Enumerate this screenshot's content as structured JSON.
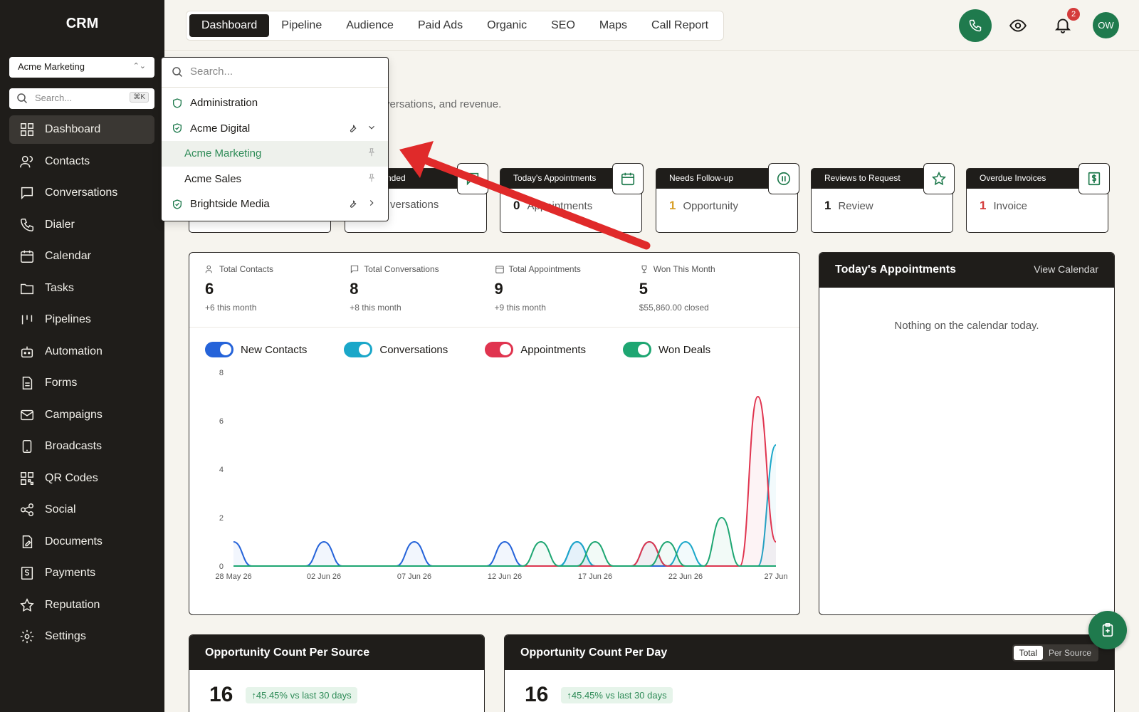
{
  "app": {
    "title": "CRM"
  },
  "sidebar": {
    "account": "Acme Marketing",
    "search_placeholder": "Search...",
    "search_shortcut": "⌘K",
    "items": [
      {
        "label": "Dashboard",
        "icon": "grid-icon"
      },
      {
        "label": "Contacts",
        "icon": "users-icon"
      },
      {
        "label": "Conversations",
        "icon": "chat-icon"
      },
      {
        "label": "Dialer",
        "icon": "phone-icon"
      },
      {
        "label": "Calendar",
        "icon": "calendar-icon"
      },
      {
        "label": "Tasks",
        "icon": "tasks-icon"
      },
      {
        "label": "Pipelines",
        "icon": "pipeline-icon"
      },
      {
        "label": "Automation",
        "icon": "robot-icon"
      },
      {
        "label": "Forms",
        "icon": "form-icon"
      },
      {
        "label": "Campaigns",
        "icon": "mail-icon"
      },
      {
        "label": "Broadcasts",
        "icon": "mobile-icon"
      },
      {
        "label": "QR Codes",
        "icon": "qr-icon"
      },
      {
        "label": "Social",
        "icon": "share-icon"
      },
      {
        "label": "Documents",
        "icon": "document-icon"
      },
      {
        "label": "Payments",
        "icon": "receipt-icon"
      },
      {
        "label": "Reputation",
        "icon": "star-icon"
      },
      {
        "label": "Settings",
        "icon": "gear-icon"
      }
    ]
  },
  "topbar": {
    "tabs": [
      "Dashboard",
      "Pipeline",
      "Audience",
      "Paid Ads",
      "Organic",
      "SEO",
      "Maps",
      "Call Report"
    ],
    "notification_count": "2",
    "avatar_initials": "OW"
  },
  "header": {
    "subtitle_fragment": "versations, and revenue."
  },
  "dropdown": {
    "search_placeholder": "Search...",
    "items": [
      {
        "label": "Administration"
      },
      {
        "label": "Acme Digital"
      },
      {
        "label": "Acme Marketing"
      },
      {
        "label": "Acme Sales"
      },
      {
        "label": "Brightside Media"
      }
    ]
  },
  "kpis": [
    {
      "title": "",
      "value": "",
      "unit": "versations"
    },
    {
      "title": "Today's Appointments",
      "value": "0",
      "unit": "Appointments"
    },
    {
      "title": "Needs Follow-up",
      "value": "1",
      "unit": "Opportunity"
    },
    {
      "title": "Reviews to Request",
      "value": "1",
      "unit": "Review"
    },
    {
      "title": "Overdue Invoices",
      "value": "1",
      "unit": "Invoice"
    }
  ],
  "kpi_partial_title": "nded",
  "stats": [
    {
      "label": "Total Contacts",
      "value": "6",
      "sub": "+6 this month"
    },
    {
      "label": "Total Conversations",
      "value": "8",
      "sub": "+8 this month"
    },
    {
      "label": "Total Appointments",
      "value": "9",
      "sub": "+9 this month"
    },
    {
      "label": "Won This Month",
      "value": "5",
      "sub": "$55,860.00 closed"
    }
  ],
  "toggles": [
    {
      "label": "New Contacts",
      "color": "#2563d9"
    },
    {
      "label": "Conversations",
      "color": "#1aa7c9"
    },
    {
      "label": "Appointments",
      "color": "#e0344f"
    },
    {
      "label": "Won Deals",
      "color": "#1ea672"
    }
  ],
  "chart_data": {
    "type": "line",
    "x": [
      "28 May 26",
      "29 May 26",
      "30 May 26",
      "31 May 26",
      "01 Jun 26",
      "02 Jun 26",
      "03 Jun 26",
      "04 Jun 26",
      "05 Jun 26",
      "06 Jun 26",
      "07 Jun 26",
      "08 Jun 26",
      "09 Jun 26",
      "10 Jun 26",
      "11 Jun 26",
      "12 Jun 26",
      "13 Jun 26",
      "14 Jun 26",
      "15 Jun 26",
      "16 Jun 26",
      "17 Jun 26",
      "18 Jun 26",
      "19 Jun 26",
      "20 Jun 26",
      "21 Jun 26",
      "22 Jun 26",
      "23 Jun 26",
      "24 Jun 26",
      "25 Jun 26",
      "26 Jun 26",
      "27 Jun 26"
    ],
    "xticks": [
      "28 May 26",
      "02 Jun 26",
      "07 Jun 26",
      "12 Jun 26",
      "17 Jun 26",
      "22 Jun 26",
      "27 Jun"
    ],
    "ylim": [
      0,
      8
    ],
    "yticks": [
      0,
      2,
      4,
      6,
      8
    ],
    "series": [
      {
        "name": "New Contacts",
        "color": "#2563d9",
        "values": [
          1,
          0,
          0,
          0,
          0,
          1,
          0,
          0,
          0,
          0,
          1,
          0,
          0,
          0,
          0,
          1,
          0,
          0,
          0,
          1,
          0,
          0,
          0,
          0,
          0,
          0,
          0,
          0,
          0,
          0,
          0
        ]
      },
      {
        "name": "Conversations",
        "color": "#1aa7c9",
        "values": [
          0,
          0,
          0,
          0,
          0,
          0,
          0,
          0,
          0,
          0,
          0,
          0,
          0,
          0,
          0,
          0,
          0,
          0,
          0,
          1,
          0,
          0,
          0,
          1,
          0,
          1,
          0,
          0,
          0,
          0,
          5
        ]
      },
      {
        "name": "Appointments",
        "color": "#e0344f",
        "values": [
          0,
          0,
          0,
          0,
          0,
          0,
          0,
          0,
          0,
          0,
          0,
          0,
          0,
          0,
          0,
          0,
          0,
          0,
          0,
          0,
          0,
          0,
          0,
          1,
          0,
          0,
          0,
          0,
          0,
          7,
          1
        ]
      },
      {
        "name": "Won Deals",
        "color": "#1ea672",
        "values": [
          0,
          0,
          0,
          0,
          0,
          0,
          0,
          0,
          0,
          0,
          0,
          0,
          0,
          0,
          0,
          0,
          0,
          1,
          0,
          0,
          1,
          0,
          0,
          0,
          1,
          0,
          0,
          2,
          0,
          0,
          0
        ]
      }
    ]
  },
  "appointments": {
    "title": "Today's Appointments",
    "link": "View Calendar",
    "empty": "Nothing on the calendar today."
  },
  "bottom": {
    "left": {
      "title": "Opportunity Count Per Source",
      "value": "16",
      "trend": "↑45.45% vs last 30 days"
    },
    "right": {
      "title": "Opportunity Count Per Day",
      "value": "16",
      "trend": "↑45.45% vs last 30 days",
      "seg_total": "Total",
      "seg_source": "Per Source"
    }
  }
}
